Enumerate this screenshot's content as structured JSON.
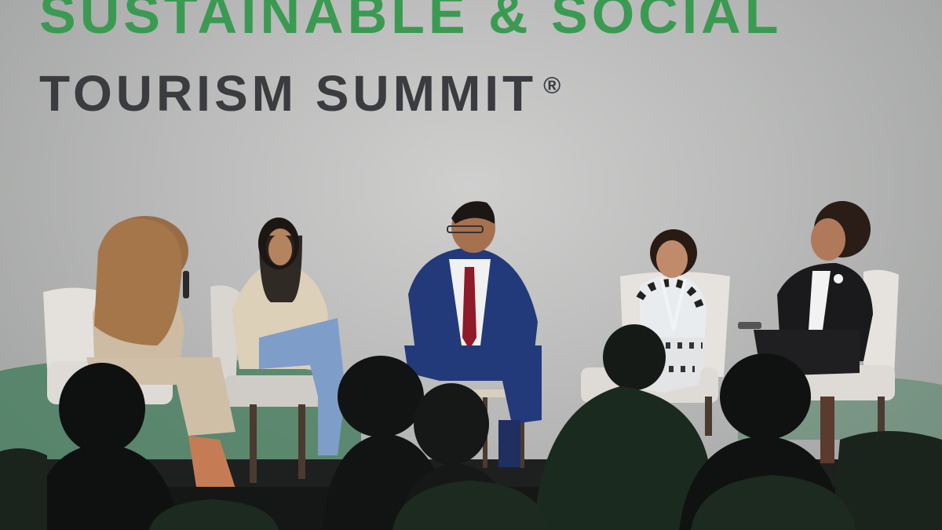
{
  "banner": {
    "line1": "SUSTAINABLE & SOCIAL",
    "line2": "TOURISM SUMMIT",
    "trademark": "®"
  },
  "colors": {
    "title_green": "#3b9a52",
    "title_dark": "#3a3c3f",
    "backdrop": "#b9bab9",
    "stage_green": "#3e7a57",
    "chair_white": "#e6e3de"
  },
  "scene": {
    "panelists": [
      {
        "role": "moderator",
        "description_icon": "moderator-with-microphone"
      },
      {
        "role": "panelist",
        "description_icon": "panelist-beige-blazer"
      },
      {
        "role": "panelist",
        "description_icon": "panelist-navy-suit"
      },
      {
        "role": "panelist",
        "description_icon": "panelist-patterned-dress"
      },
      {
        "role": "panelist",
        "description_icon": "panelist-black-suit"
      }
    ]
  }
}
